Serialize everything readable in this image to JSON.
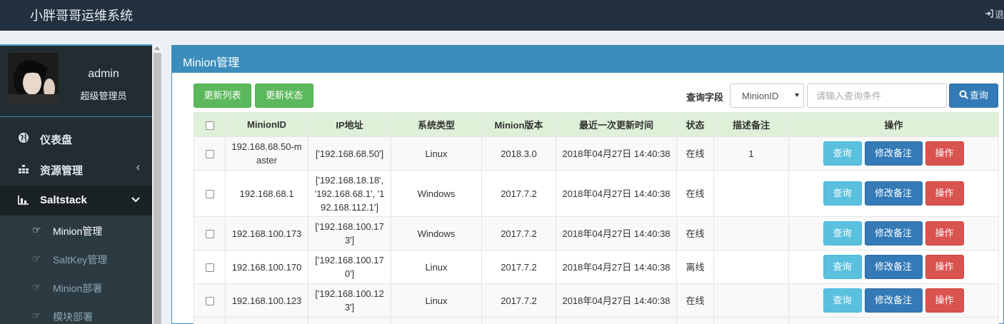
{
  "app": {
    "title": "小胖哥哥运维系统",
    "logout_label": "退"
  },
  "user": {
    "name": "admin",
    "role": "超级管理员"
  },
  "sidebar": {
    "items": [
      {
        "label": "仪表盘",
        "icon": "globe-icon"
      },
      {
        "label": "资源管理",
        "icon": "sitemap-icon"
      },
      {
        "label": "Saltstack",
        "icon": "chart-icon"
      }
    ],
    "subitems": [
      {
        "label": "Minion管理"
      },
      {
        "label": "SaltKey管理"
      },
      {
        "label": "Minion部署"
      },
      {
        "label": "模块部署"
      }
    ]
  },
  "main": {
    "title": "Minion管理",
    "btn_refresh_list": "更新列表",
    "btn_refresh_status": "更新状态",
    "search_label": "查询字段",
    "search_field_value": "MinionID",
    "search_placeholder": "请输入查询条件",
    "search_button": "查询"
  },
  "table": {
    "headers": [
      "MinionID",
      "IP地址",
      "系统类型",
      "Minion版本",
      "最近一次更新时间",
      "状态",
      "描述备注",
      "操作"
    ],
    "action_labels": {
      "query": "查询",
      "edit_note": "修改备注",
      "operate": "操作"
    },
    "rows": [
      {
        "id": "192.168.68.50-master",
        "ip": "['192.168.68.50']",
        "os": "Linux",
        "version": "2018.3.0",
        "updated": "2018年04月27日 14:40:38",
        "status": "在线",
        "online": true,
        "note": "1"
      },
      {
        "id": "192.168.68.1",
        "ip": "['192.168.18.18', '192.168.68.1', '192.168.112.1']",
        "os": "Windows",
        "version": "2017.7.2",
        "updated": "2018年04月27日 14:40:38",
        "status": "在线",
        "online": true,
        "note": ""
      },
      {
        "id": "192.168.100.173",
        "ip": "['192.168.100.173']",
        "os": "Windows",
        "version": "2017.7.2",
        "updated": "2018年04月27日 14:40:38",
        "status": "在线",
        "online": true,
        "note": ""
      },
      {
        "id": "192.168.100.170",
        "ip": "['192.168.100.170']",
        "os": "Linux",
        "version": "2017.7.2",
        "updated": "2018年04月27日 14:40:38",
        "status": "离线",
        "online": false,
        "note": ""
      },
      {
        "id": "192.168.100.123",
        "ip": "['192.168.100.123']",
        "os": "Linux",
        "version": "2017.7.2",
        "updated": "2018年04月27日 14:40:38",
        "status": "在线",
        "online": true,
        "note": ""
      }
    ]
  },
  "colors": {
    "topbar": "#22303f",
    "sidebar": "#222d32",
    "primary": "#3c8dbc",
    "online": "#3ca53c",
    "offline": "#a0312c"
  }
}
